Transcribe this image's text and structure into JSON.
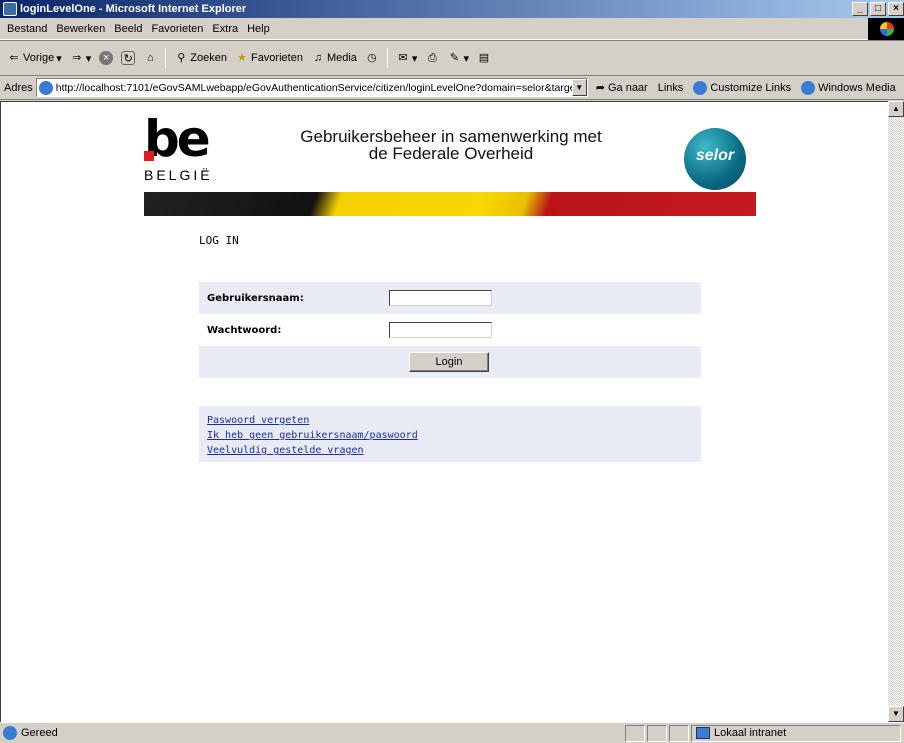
{
  "window": {
    "title": "loginLevelOne - Microsoft Internet Explorer"
  },
  "menu": [
    "Bestand",
    "Bewerken",
    "Beeld",
    "Favorieten",
    "Extra",
    "Help"
  ],
  "toolbar": {
    "back_label": "Vorige",
    "search_label": "Zoeken",
    "favorites_label": "Favorieten",
    "media_label": "Media"
  },
  "address": {
    "label": "Adres",
    "url": "http://localhost:7101/eGovSAMLwebapp/eGovAuthenticationService/citizen/loginLevelOne?domain=selor&target=htt",
    "go_label": "Ga naar",
    "links_label": "Links",
    "links": [
      "Customize Links",
      "Windows Media"
    ]
  },
  "page": {
    "logo_be_word": "be",
    "logo_country": "BELGIË",
    "header_line1": "Gebruikersbeheer in samenwerking met",
    "header_line2": "de Federale Overheid",
    "selor_text": "selor",
    "login_title": "LOG IN",
    "form": {
      "username_label": "Gebruikersnaam:",
      "username_value": "",
      "password_label": "Wachtwoord:",
      "password_value": "",
      "login_button": "Login"
    },
    "links": [
      "Paswoord vergeten",
      "Ik heb geen gebruikersnaam/paswoord",
      "Veelvuldig gestelde vragen"
    ]
  },
  "status": {
    "text": "Gereed",
    "zone": "Lokaal intranet"
  }
}
